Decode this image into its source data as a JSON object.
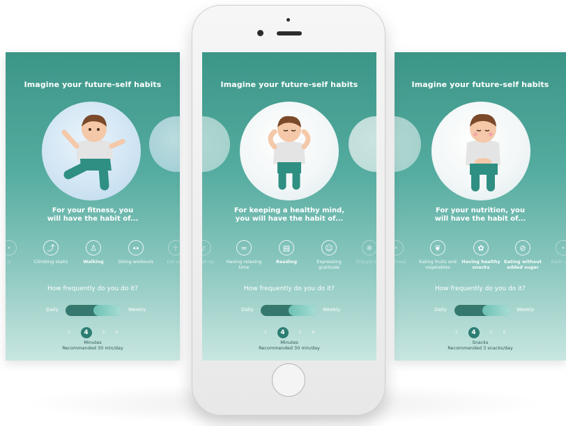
{
  "screens": {
    "left": {
      "title": "Imagine your future-self habits",
      "subtitle_line1": "For your fitness,  you",
      "subtitle_line2": "will have the habit of...",
      "habits": [
        {
          "label": "ly",
          "icon": "partial-icon"
        },
        {
          "label": "Climbing stairs",
          "icon": "stairs-icon"
        },
        {
          "label": "Walking",
          "icon": "walking-icon"
        },
        {
          "label": "Doing workouts",
          "icon": "dumbbell-icon"
        },
        {
          "label": "Doi yog",
          "icon": "yoga-icon"
        }
      ],
      "question": "How frequently do you do it?",
      "freq_left": "Daily",
      "freq_right": "Weekly",
      "numbers": [
        "3",
        "4",
        "5",
        "6"
      ],
      "selected": "4",
      "unit": "Minutes",
      "recommended": "Recommended 30 min/day"
    },
    "center": {
      "title": "Imagine your future-self habits",
      "subtitle_line1": "For keeping a healthy mind,",
      "subtitle_line2": "you will have the habit of...",
      "habits": [
        {
          "label": "nough ep",
          "icon": "sleep-icon"
        },
        {
          "label": "Having relaxing time",
          "icon": "relax-icon"
        },
        {
          "label": "Reading",
          "icon": "reading-icon"
        },
        {
          "label": "Expressing gratitude",
          "icon": "gratitude-icon"
        },
        {
          "label": "Enjoyin thin",
          "icon": "enjoy-icon"
        }
      ],
      "question": "How frequently do you do it?",
      "freq_left": "Daily",
      "freq_right": "Weekly",
      "numbers": [
        "3",
        "4",
        "5",
        "6"
      ],
      "selected": "4",
      "unit": "Minutes",
      "recommended": "Recommended 30 min/day"
    },
    "right": {
      "title": "Imagine your future-self habits",
      "subtitle_line1": "For your nutrition,  you",
      "subtitle_line2": "will have the habit of...",
      "habits": [
        {
          "label": "g a meal",
          "icon": "meal-icon"
        },
        {
          "label": "Eating fruits and vegetables",
          "icon": "fruit-icon"
        },
        {
          "label": "Having healthy snacks",
          "icon": "snack-icon"
        },
        {
          "label": "Eating without added sugar",
          "icon": "no-sugar-icon"
        },
        {
          "label": "Eatin vege",
          "icon": "veg-icon"
        }
      ],
      "question": "How frequently do you do it?",
      "freq_left": "Daily",
      "freq_right": "Weekly",
      "numbers": [
        "3",
        "4",
        "5",
        "6"
      ],
      "selected": "4",
      "unit": "Snacks",
      "recommended": "Recommended 3 snacks/day"
    }
  },
  "colors": {
    "teal_dark": "#3c9688",
    "teal_light": "#c9e6e1",
    "toggle_knob": "#6cc1b4",
    "selected_badge": "#2c7d72",
    "skin": "#f4c8a8",
    "hair": "#7a4a2a",
    "shirt": "#e4e4e4",
    "pants": "#2f8f83"
  }
}
